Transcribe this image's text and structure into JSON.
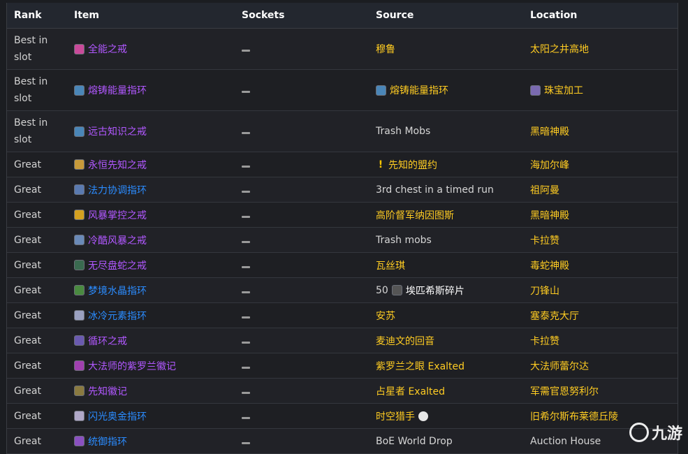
{
  "headers": {
    "rank": "Rank",
    "item": "Item",
    "sockets": "Sockets",
    "source": "Source",
    "location": "Location"
  },
  "rows": [
    {
      "rank": "Best in slot",
      "item": "全能之戒",
      "item_color": "purple",
      "icon_color": "#c94a9a",
      "source": "穆鲁",
      "source_color": "gold",
      "location": "太阳之井高地",
      "loc_color": "gold",
      "tall": true
    },
    {
      "rank": "Best in slot",
      "item": "熔铸能量指环",
      "item_color": "purple",
      "icon_color": "#4a86b8",
      "source": "熔铸能量指环",
      "source_color": "gold",
      "source_icon": "#4a86b8",
      "location": "珠宝加工",
      "loc_color": "gold",
      "loc_icon": "#7a6ab0",
      "tall": true
    },
    {
      "rank": "Best in slot",
      "item": "远古知识之戒",
      "item_color": "purple",
      "icon_color": "#4a86b8",
      "source": "Trash Mobs",
      "source_color": "plain",
      "location": "黑暗神殿",
      "loc_color": "gold",
      "tall": true
    },
    {
      "rank": "Great",
      "item": "永恒先知之戒",
      "item_color": "purple",
      "icon_color": "#c79a3a",
      "source": "先知的盟约",
      "source_color": "gold",
      "source_bang": "!",
      "location": "海加尔峰",
      "loc_color": "gold"
    },
    {
      "rank": "Great",
      "item": "法力协调指环",
      "item_color": "blue",
      "icon_color": "#5a7ab0",
      "source": "3rd chest in a timed run",
      "source_color": "plain",
      "location": "祖阿曼",
      "loc_color": "gold"
    },
    {
      "rank": "Great",
      "item": "风暴掌控之戒",
      "item_color": "purple",
      "icon_color": "#d4a020",
      "source": "高阶督军纳因图斯",
      "source_color": "gold",
      "location": "黑暗神殿",
      "loc_color": "gold"
    },
    {
      "rank": "Great",
      "item": "冷酷风暴之戒",
      "item_color": "purple",
      "icon_color": "#6a8ab8",
      "source": "Trash mobs",
      "source_color": "plain",
      "location": "卡拉赞",
      "loc_color": "gold"
    },
    {
      "rank": "Great",
      "item": "无尽盘蛇之戒",
      "item_color": "purple",
      "icon_color": "#3a6a50",
      "source": "瓦丝琪",
      "source_color": "gold",
      "location": "毒蛇神殿",
      "loc_color": "gold"
    },
    {
      "rank": "Great",
      "item": "梦境水晶指环",
      "item_color": "blue",
      "icon_color": "#4a8a40",
      "source_prefix": "50",
      "source": "埃匹希斯碎片",
      "source_color": "white",
      "source_icon": "#555555",
      "location": "刀锋山",
      "loc_color": "gold"
    },
    {
      "rank": "Great",
      "item": "冰冷元素指环",
      "item_color": "blue",
      "icon_color": "#9aa0c0",
      "source": "安苏",
      "source_color": "gold",
      "location": "塞泰克大厅",
      "loc_color": "gold"
    },
    {
      "rank": "Great",
      "item": "循环之戒",
      "item_color": "purple",
      "icon_color": "#6a5ab0",
      "source": "麦迪文的回音",
      "source_color": "gold",
      "location": "卡拉赞",
      "loc_color": "gold"
    },
    {
      "rank": "Great",
      "item": "大法师的紫罗兰徽记",
      "item_color": "purple",
      "icon_color": "#a040b0",
      "source": "紫罗兰之眼 Exalted",
      "source_color": "gold",
      "source_exalted": true,
      "location": "大法师蕾尔达",
      "loc_color": "gold"
    },
    {
      "rank": "Great",
      "item": "先知徽记",
      "item_color": "purple",
      "icon_color": "#8a7a40",
      "source": "占星者 Exalted",
      "source_color": "gold",
      "source_exalted": true,
      "location": "军需官恩努利尔",
      "loc_color": "gold"
    },
    {
      "rank": "Great",
      "item": "闪光奥金指环",
      "item_color": "blue",
      "icon_color": "#b0a8c8",
      "source": "时空猎手",
      "source_color": "gold",
      "source_skull": true,
      "location": "旧希尔斯布莱德丘陵",
      "loc_color": "gold"
    },
    {
      "rank": "Great",
      "item": "统御指环",
      "item_color": "blue",
      "icon_color": "#8a50c0",
      "source": "BoE World Drop",
      "source_color": "plain",
      "location": "Auction House",
      "loc_color": "plain"
    }
  ],
  "watermark": "九游"
}
